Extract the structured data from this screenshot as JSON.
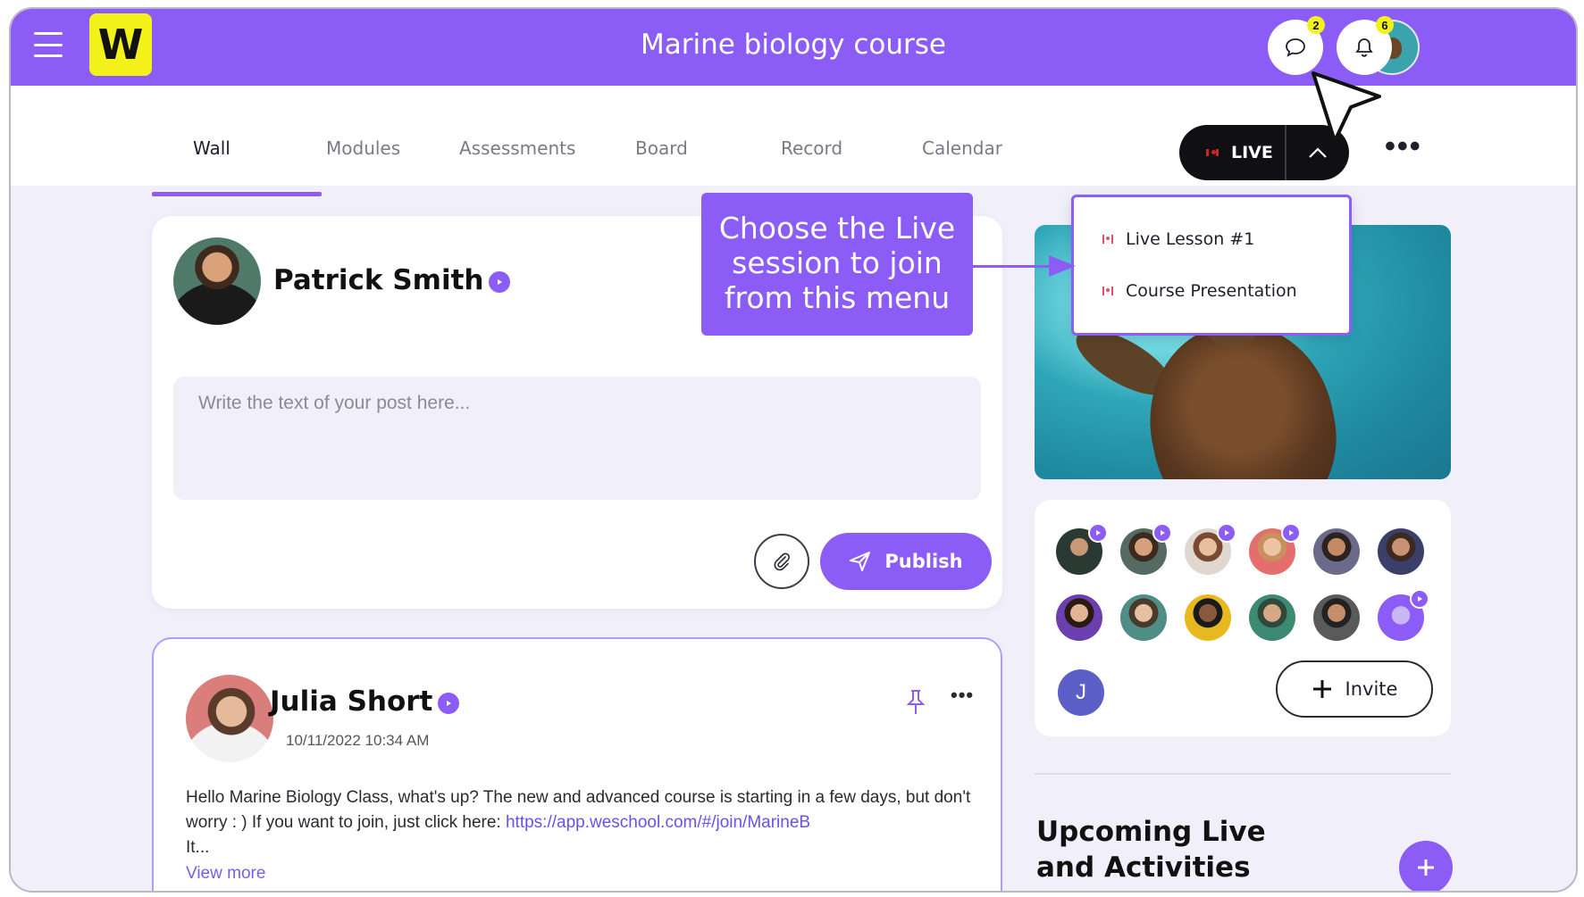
{
  "header": {
    "logo_text": "W",
    "course_title": "Marine biology course",
    "messages_count": "2",
    "notifications_count": "6"
  },
  "tabs": [
    {
      "label": "Wall",
      "active": true
    },
    {
      "label": "Modules"
    },
    {
      "label": "Assessments"
    },
    {
      "label": "Board"
    },
    {
      "label": "Record"
    },
    {
      "label": "Calendar"
    }
  ],
  "live_button": {
    "label": "LIVE"
  },
  "live_menu": {
    "items": [
      "Live Lesson #1",
      "Course Presentation"
    ]
  },
  "callout": {
    "text": "Choose the Live session to join from this menu"
  },
  "composer": {
    "author": "Patrick Smith",
    "placeholder": "Write the text of your post here...",
    "publish_label": "Publish"
  },
  "post": {
    "author": "Julia Short",
    "date": "10/11/2022 10:34 AM",
    "body_text": "Hello Marine Biology Class, what's up? The new and advanced course is starting in a few days, but don't worry : ) If you want to join, just click here: ",
    "link_text": "https://app.weschool.com/#/join/MarineB",
    "body_tail": "It...",
    "view_more": "View more"
  },
  "members": {
    "initial_avatar": "J",
    "invite_label": "Invite"
  },
  "upcoming": {
    "title": "Upcoming Live and Activities"
  },
  "colors": {
    "accent": "#8b5cf6",
    "logo_bg": "#f2f21a",
    "badge_bg": "#f2f21a",
    "live_bg": "#0f0f14"
  }
}
